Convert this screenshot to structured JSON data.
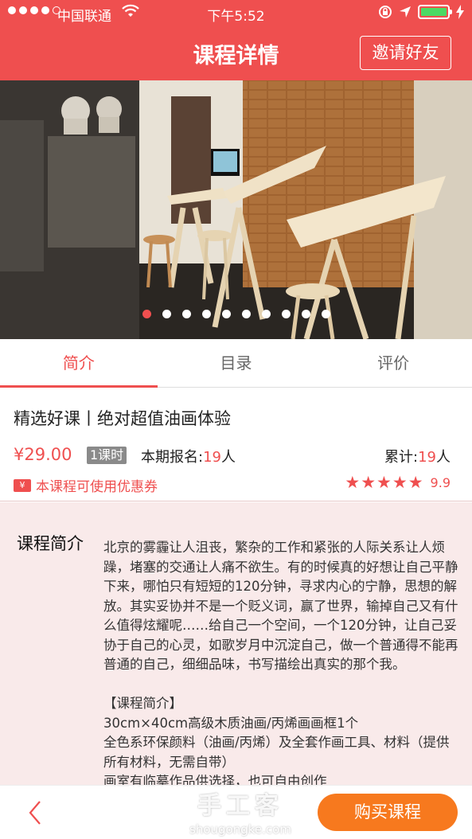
{
  "status_bar": {
    "carrier": "中国联通",
    "time": "下午5:52",
    "battery_level": 1.0
  },
  "nav": {
    "title": "课程详情",
    "invite_label": "邀请好友"
  },
  "carousel": {
    "slide_count": 10,
    "active_index": 0
  },
  "tabs": [
    {
      "label": "简介",
      "active": true
    },
    {
      "label": "目录",
      "active": false
    },
    {
      "label": "评价",
      "active": false
    }
  ],
  "course": {
    "title": "精选好课丨绝对超值油画体验",
    "price": "¥29.00",
    "lessons": "1课时",
    "enroll_label": "本期报名:",
    "enroll_count": "19",
    "enroll_unit": "人",
    "total_label": "累计:",
    "total_count": "19",
    "total_unit": "人",
    "coupon_icon": "¥",
    "coupon_text": "本课程可使用优惠券",
    "stars": 5,
    "score": "9.9"
  },
  "intro": {
    "heading": "课程简介",
    "body": "北京的雾霾让人沮丧，繁杂的工作和紧张的人际关系让人烦躁，堵塞的交通让人痛不欲生。有的时候真的好想让自己平静下来，哪怕只有短短的120分钟，寻求内心的宁静，思想的解放。其实妥协并不是一个贬义词，赢了世界，输掉自己又有什么值得炫耀呢……给自己一个空间，一个120分钟，让自己妥协于自己的心灵，如歌岁月中沉淀自己，做一个普通得不能再普通的自己，细细品味，书写描绘出真实的那个我。\n\n【课程简介】\n30cm×40cm高级木质油画/丙烯画画框1个\n全色系环保颜料（油画/丙烯）及全套作画工具、材料（提供所有材料，无需自带）\n画室有临摹作品供选择，也可自由创作"
  },
  "bottom_bar": {
    "watermark_cn": "手工客",
    "watermark_en": "shougongke.com",
    "buy_label": "购买课程"
  },
  "colors": {
    "brand_red": "#ef4f4f",
    "buy_orange": "#f7791e",
    "intro_bg": "#f9eaea"
  }
}
